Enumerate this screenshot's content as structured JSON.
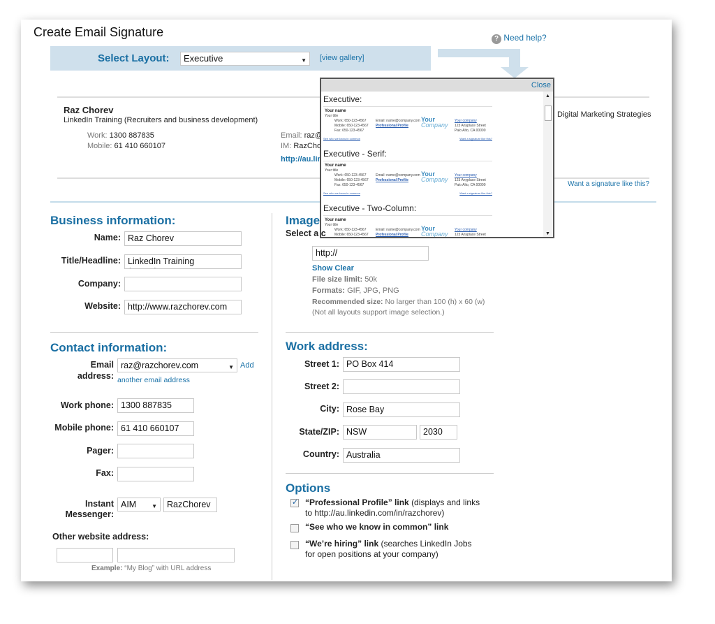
{
  "title": "Create Email Signature",
  "help": "Need help?",
  "layout": {
    "label": "Select Layout:",
    "value": "Executive",
    "gallery": "[view gallery]"
  },
  "preview": {
    "name": "Raz Chorev",
    "headline": "LinkedIn Training (Recruiters and business development)",
    "work_label": "Work:",
    "work": "1300 887835",
    "mobile_label": "Mobile:",
    "mobile": "61 410 660107",
    "email_label": "Email:",
    "email": "raz@",
    "im_label": "IM:",
    "im": "RazChor",
    "link": "http://au.lin",
    "company": "Digital Marketing Strategies",
    "want": "Want a signature like this?"
  },
  "gallery": {
    "close": "Close",
    "items": [
      {
        "title": "Executive:",
        "name": "Your name",
        "sub": "Your title",
        "l1": "Work: 650-123-4567",
        "l2": "Mobile: 650-123-4567",
        "l3": "Fax: 650-123-4567",
        "email": "Email: name@company.com",
        "profile": "Professional Profile",
        "logo1": "Your",
        "logo2": "Company",
        "co": "Your company",
        "addr1": "123 Anyplace Street",
        "addr2": "Palo Alto, CA 00000",
        "see": "See who we know in common",
        "want": "Want a signature like this?"
      },
      {
        "title": "Executive - Serif:",
        "name": "Your name",
        "sub": "Your title",
        "l1": "Work: 650-123-4567",
        "l2": "Mobile: 650-123-4567",
        "l3": "Fax: 650-123-4567",
        "email": "Email: name@company.com",
        "profile": "Professional Profile",
        "logo1": "Your",
        "logo2": "Company",
        "co": "Your company",
        "addr1": "123 Anyplace Street",
        "addr2": "Palo Alto, CA 00000",
        "see": "See who we know in common",
        "want": "Want a signature like this?"
      },
      {
        "title": "Executive - Two-Column:",
        "name": "Your name",
        "sub": "Your title",
        "l1": "Work: 650-123-4567",
        "l2": "Mobile: 650-123-4567",
        "l3": "Fax: 650-123-4567",
        "email": "Email: name@company.com",
        "profile": "Professional Profile",
        "logo1": "Your",
        "logo2": "Company",
        "co": "Your company",
        "addr1": "123 Anyplace Street"
      }
    ]
  },
  "business": {
    "heading": "Business information:",
    "name_label": "Name:",
    "name": "Raz Chorev",
    "title_label": "Title/Headline:",
    "title": "LinkedIn Training (Recruiters",
    "company_label": "Company:",
    "company": "",
    "website_label": "Website:",
    "website": "http://www.razchorev.com"
  },
  "contact": {
    "heading": "Contact information:",
    "email_label1": "Email",
    "email_label2": "address:",
    "email": "raz@razchorev.com",
    "add1": "Add",
    "add2": "another email address",
    "work_label": "Work phone:",
    "work": "1300 887835",
    "mobile_label": "Mobile phone:",
    "mobile": "61 410 660107",
    "pager_label": "Pager:",
    "fax_label": "Fax:",
    "im_label1": "Instant",
    "im_label2": "Messenger:",
    "im_type": "AIM",
    "im": "RazChorev",
    "other_label": "Other website address:",
    "example_label": "Example:",
    "example": "“My Blog” with URL address"
  },
  "image": {
    "heading": "Image",
    "sub": "Select a c",
    "url": "http://",
    "show": "Show",
    "clear": "Clear",
    "size_label": "File size limit:",
    "size": "50k",
    "formats_label": "Formats:",
    "formats": "GIF, JPG, PNG",
    "rec_label": "Recommended size:",
    "rec": "No larger than 100 (h) x 60 (w)",
    "note": "(Not all layouts support image selection.)"
  },
  "address": {
    "heading": "Work address:",
    "street1_label": "Street 1:",
    "street1": "PO Box 414",
    "street2_label": "Street 2:",
    "street2": "",
    "city_label": "City:",
    "city": "Rose Bay",
    "state_label": "State/ZIP:",
    "state": "NSW",
    "zip": "2030",
    "country_label": "Country:",
    "country": "Australia"
  },
  "options": {
    "heading": "Options",
    "o1_b": "“Professional Profile” link",
    "o1": "(displays and links",
    "o1_2": "to http://au.linkedin.com/in/razchorev)",
    "o1_checked": true,
    "o2_b": "“See who we know in common” link",
    "o2_checked": false,
    "o3_b": "“We’re hiring” link",
    "o3": "(searches LinkedIn Jobs",
    "o3_2": "for open positions at your company)",
    "o3_checked": false
  },
  "colors": {
    "accent": "#1a6fa3",
    "layout_bar": "#cfe0ec"
  }
}
